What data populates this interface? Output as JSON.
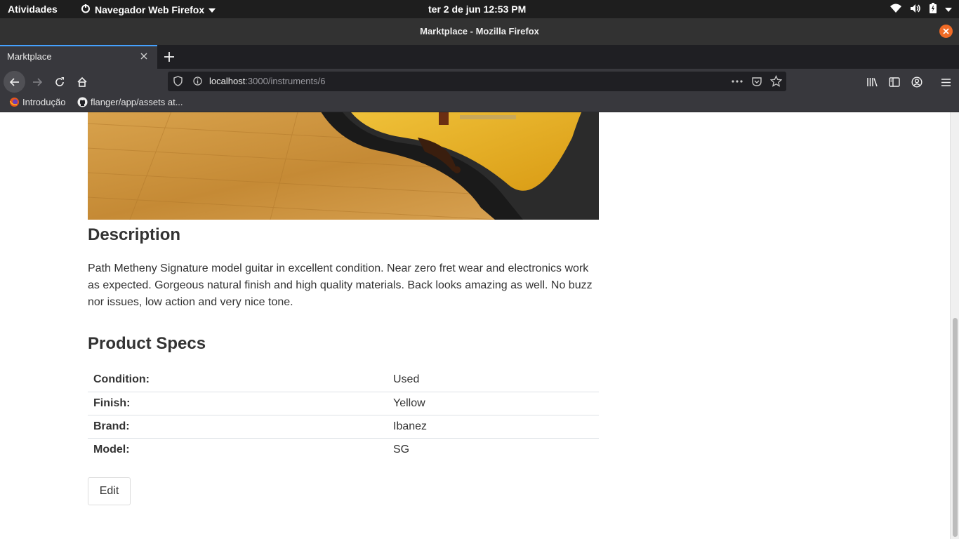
{
  "system": {
    "activities": "Atividades",
    "app_menu": "Navegador Web Firefox",
    "clock": "ter 2 de jun  12:53 PM"
  },
  "window": {
    "title": "Marktplace - Mozilla Firefox"
  },
  "tabs": [
    {
      "label": "Marktplace",
      "active": true
    }
  ],
  "urlbar": {
    "host": "localhost",
    "rest": ":3000/instruments/6"
  },
  "bookmarks": [
    {
      "label": "Introdução",
      "icon": "firefox-icon"
    },
    {
      "label": "flanger/app/assets at...",
      "icon": "github-icon"
    }
  ],
  "page": {
    "description_heading": "Description",
    "description_text": "Path Metheny Signature model guitar in excellent condition. Near zero fret wear and electronics work as expected. Gorgeous natural finish and high quality materials. Back looks amazing as well. No buzz nor issues, low action and very nice tone.",
    "specs_heading": "Product Specs",
    "specs": [
      {
        "label": "Condition:",
        "value": "Used"
      },
      {
        "label": "Finish:",
        "value": "Yellow"
      },
      {
        "label": "Brand:",
        "value": "Ibanez"
      },
      {
        "label": "Model:",
        "value": "SG"
      }
    ],
    "edit_label": "Edit"
  },
  "colors": {
    "accent_tab": "#45a1ff",
    "close_button": "#f06b26",
    "text": "#333333"
  }
}
